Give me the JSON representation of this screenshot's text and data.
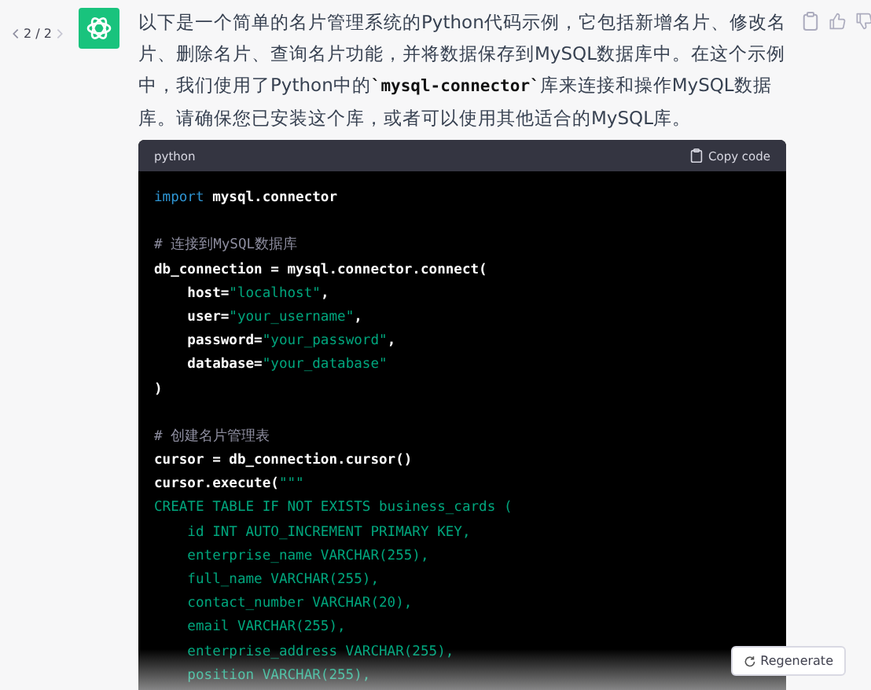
{
  "message": {
    "pager": "2 / 2",
    "paragraph": [
      {
        "kind": "text",
        "text": "以下是一个简单的名片管理系统的Python代码示例，它包括新增名片、修改名片、删除名片、查询名片功能，并将数据保存到MySQL数据库中。在这个示例中，我们使用了Python中的"
      },
      {
        "kind": "code",
        "text": "`mysql-connector`"
      },
      {
        "kind": "text",
        "text": "库来连接和操作MySQL数据库。请确保您已安装这个库，或者可以使用其他适合的MySQL库。"
      }
    ],
    "code_block": {
      "language": "python",
      "copy_label": "Copy code",
      "lines": [
        {
          "kind": "code",
          "tokens": [
            {
              "kind": "keyword",
              "text": "import"
            },
            {
              "kind": "plain",
              "text": " mysql.connector"
            }
          ]
        },
        {
          "kind": "blank"
        },
        {
          "kind": "code",
          "tokens": [
            {
              "kind": "comment",
              "text": "# 连接到MySQL数据库"
            }
          ]
        },
        {
          "kind": "code",
          "tokens": [
            {
              "kind": "plain",
              "text": "db_connection = mysql.connector.connect("
            }
          ]
        },
        {
          "kind": "code",
          "tokens": [
            {
              "kind": "plain",
              "text": "    host="
            },
            {
              "kind": "string",
              "text": "\"localhost\""
            },
            {
              "kind": "plain",
              "text": ","
            }
          ]
        },
        {
          "kind": "code",
          "tokens": [
            {
              "kind": "plain",
              "text": "    user="
            },
            {
              "kind": "string",
              "text": "\"your_username\""
            },
            {
              "kind": "plain",
              "text": ","
            }
          ]
        },
        {
          "kind": "code",
          "tokens": [
            {
              "kind": "plain",
              "text": "    password="
            },
            {
              "kind": "string",
              "text": "\"your_password\""
            },
            {
              "kind": "plain",
              "text": ","
            }
          ]
        },
        {
          "kind": "code",
          "tokens": [
            {
              "kind": "plain",
              "text": "    database="
            },
            {
              "kind": "string",
              "text": "\"your_database\""
            }
          ]
        },
        {
          "kind": "code",
          "tokens": [
            {
              "kind": "plain",
              "text": ")"
            }
          ]
        },
        {
          "kind": "blank"
        },
        {
          "kind": "code",
          "tokens": [
            {
              "kind": "comment",
              "text": "# 创建名片管理表"
            }
          ]
        },
        {
          "kind": "code",
          "tokens": [
            {
              "kind": "plain",
              "text": "cursor = db_connection.cursor()"
            }
          ]
        },
        {
          "kind": "code",
          "tokens": [
            {
              "kind": "plain",
              "text": "cursor.execute("
            },
            {
              "kind": "string",
              "text": "\"\"\""
            }
          ]
        },
        {
          "kind": "code",
          "tokens": [
            {
              "kind": "string",
              "text": "CREATE TABLE IF NOT EXISTS business_cards ("
            }
          ]
        },
        {
          "kind": "code",
          "tokens": [
            {
              "kind": "string",
              "text": "    id INT AUTO_INCREMENT PRIMARY KEY,"
            }
          ]
        },
        {
          "kind": "code",
          "tokens": [
            {
              "kind": "string",
              "text": "    enterprise_name VARCHAR(255),"
            }
          ]
        },
        {
          "kind": "code",
          "tokens": [
            {
              "kind": "string",
              "text": "    full_name VARCHAR(255),"
            }
          ]
        },
        {
          "kind": "code",
          "tokens": [
            {
              "kind": "string",
              "text": "    contact_number VARCHAR(20),"
            }
          ]
        },
        {
          "kind": "code",
          "tokens": [
            {
              "kind": "string",
              "text": "    email VARCHAR(255),"
            }
          ]
        },
        {
          "kind": "code",
          "tokens": [
            {
              "kind": "string",
              "text": "    enterprise_address VARCHAR(255),"
            }
          ]
        },
        {
          "kind": "code",
          "tokens": [
            {
              "kind": "string",
              "text": "    position VARCHAR(255),"
            }
          ]
        }
      ]
    }
  },
  "regenerate_button": {
    "label": "Regenerate"
  }
}
